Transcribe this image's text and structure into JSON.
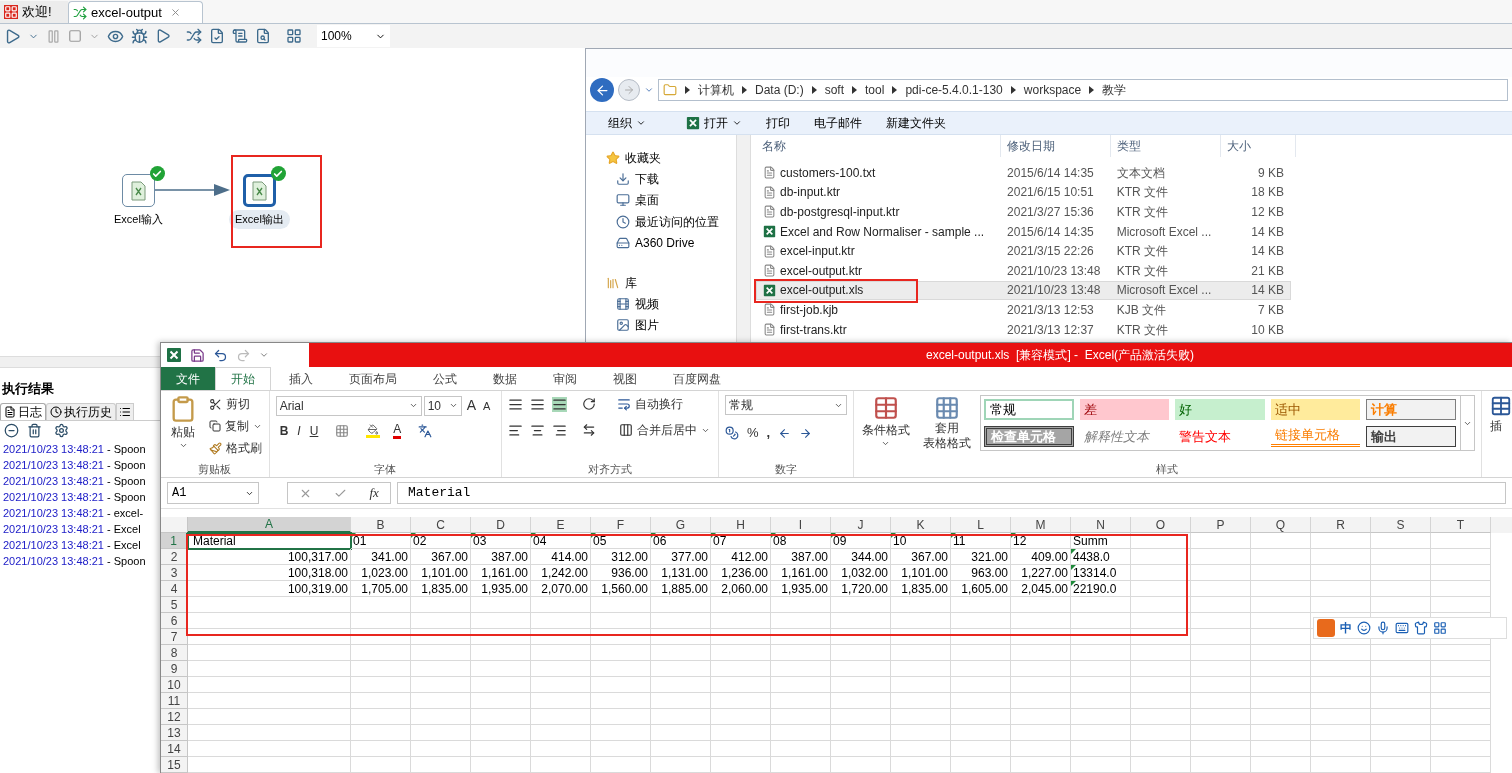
{
  "spoon": {
    "tabs": [
      {
        "label": "欢迎!",
        "selected": false
      },
      {
        "label": "excel-output",
        "selected": true
      }
    ],
    "zoom": "100%",
    "steps": [
      {
        "label": "Excel输入",
        "selected": false
      },
      {
        "label": "Excel输出",
        "selected": true
      }
    ],
    "results": {
      "title": "执行结果",
      "tabs": [
        {
          "label": "日志",
          "selected": true
        },
        {
          "label": "执行历史",
          "selected": false
        }
      ],
      "log": [
        {
          "time": "2021/10/23 13:48:21",
          "message": "- Spoon"
        },
        {
          "time": "2021/10/23 13:48:21",
          "message": "- Spoon"
        },
        {
          "time": "2021/10/23 13:48:21",
          "message": "- Spoon"
        },
        {
          "time": "2021/10/23 13:48:21",
          "message": "- Spoon"
        },
        {
          "time": "2021/10/23 13:48:21",
          "message": "- excel-"
        },
        {
          "time": "2021/10/23 13:48:21",
          "message": "- Excel"
        },
        {
          "time": "2021/10/23 13:48:21",
          "message": "- Excel"
        },
        {
          "time": "2021/10/23 13:48:21",
          "message": "- Spoon"
        }
      ]
    }
  },
  "explorer": {
    "path": [
      "计算机",
      "Data (D:)",
      "soft",
      "tool",
      "pdi-ce-5.4.0.1-130",
      "workspace",
      "教学"
    ],
    "toolbar": [
      "组织",
      "打开",
      "打印",
      "电子邮件",
      "新建文件夹"
    ],
    "nav": [
      {
        "label": "收藏夹",
        "children": [
          {
            "label": "下载"
          },
          {
            "label": "桌面"
          },
          {
            "label": "最近访问的位置"
          },
          {
            "label": "A360 Drive"
          }
        ]
      },
      {
        "label": "库",
        "children": [
          {
            "label": "视频"
          },
          {
            "label": "图片"
          }
        ]
      }
    ],
    "columns": [
      "名称",
      "修改日期",
      "类型",
      "大小"
    ],
    "files": [
      {
        "name": "customers-100.txt",
        "date": "2015/6/14 14:35",
        "type": "文本文档",
        "size": "9 KB",
        "kind": "text",
        "selected": false
      },
      {
        "name": "db-input.ktr",
        "date": "2021/6/15 10:51",
        "type": "KTR 文件",
        "size": "18 KB",
        "kind": "text",
        "selected": false
      },
      {
        "name": "db-postgresql-input.ktr",
        "date": "2021/3/27 15:36",
        "type": "KTR 文件",
        "size": "12 KB",
        "kind": "text",
        "selected": false
      },
      {
        "name": "Excel and Row Normaliser - sample ...",
        "date": "2015/6/14 14:35",
        "type": "Microsoft Excel ...",
        "size": "14 KB",
        "kind": "excel",
        "selected": false
      },
      {
        "name": "excel-input.ktr",
        "date": "2021/3/15 22:26",
        "type": "KTR 文件",
        "size": "14 KB",
        "kind": "text",
        "selected": false
      },
      {
        "name": "excel-output.ktr",
        "date": "2021/10/23 13:48",
        "type": "KTR 文件",
        "size": "21 KB",
        "kind": "text",
        "selected": false
      },
      {
        "name": "excel-output.xls",
        "date": "2021/10/23 13:48",
        "type": "Microsoft Excel ...",
        "size": "14 KB",
        "kind": "excel",
        "selected": true
      },
      {
        "name": "first-job.kjb",
        "date": "2021/3/13 12:53",
        "type": "KJB 文件",
        "size": "7 KB",
        "kind": "text",
        "selected": false
      },
      {
        "name": "first-trans.ktr",
        "date": "2021/3/13 12:37",
        "type": "KTR 文件",
        "size": "10 KB",
        "kind": "text",
        "selected": false
      }
    ]
  },
  "excel": {
    "title": "excel-output.xls  [兼容模式] -  Excel(产品激活失败)",
    "tabs": [
      {
        "label": "文件",
        "selected": false
      },
      {
        "label": "开始",
        "selected": true
      },
      {
        "label": "插入",
        "selected": false
      },
      {
        "label": "页面布局",
        "selected": false
      },
      {
        "label": "公式",
        "selected": false
      },
      {
        "label": "数据",
        "selected": false
      },
      {
        "label": "审阅",
        "selected": false
      },
      {
        "label": "视图",
        "selected": false
      },
      {
        "label": "百度网盘",
        "selected": false
      }
    ],
    "clipboard": {
      "group": "剪贴板",
      "paste": "粘贴",
      "cut": "剪切",
      "copy": "复制",
      "painter": "格式刷"
    },
    "font": {
      "group": "字体",
      "name": "Arial",
      "size": "10",
      "grow": "A",
      "shrink": "A",
      "bold": "B",
      "italic": "I",
      "underline": "U",
      "font_color_label": "A"
    },
    "alignment": {
      "group": "对齐方式",
      "wrap": "自动换行",
      "merge": "合并后居中"
    },
    "number": {
      "group": "数字",
      "format": "常规",
      "percent": "%",
      "comma": ","
    },
    "styles": {
      "group": "样式",
      "conditional": "条件格式",
      "table": [
        "套用",
        "表格格式"
      ],
      "cells": [
        {
          "label": "常规",
          "kind": "normal"
        },
        {
          "label": "差",
          "kind": "bad"
        },
        {
          "label": "好",
          "kind": "good"
        },
        {
          "label": "适中",
          "kind": "neutral"
        },
        {
          "label": "计算",
          "kind": "calculation"
        },
        {
          "label": "检查单元格",
          "kind": "check"
        },
        {
          "label": "解释性文本",
          "kind": "explanatory"
        },
        {
          "label": "警告文本",
          "kind": "warning"
        },
        {
          "label": "链接单元格",
          "kind": "linked"
        },
        {
          "label": "输出",
          "kind": "output"
        }
      ]
    },
    "insert_cut": "插",
    "name_box": "A1",
    "fx": "fx",
    "formula": "Material",
    "columns": [
      {
        "letter": "A",
        "selected": true
      },
      {
        "letter": "B",
        "selected": false
      },
      {
        "letter": "C",
        "selected": false
      },
      {
        "letter": "D",
        "selected": false
      },
      {
        "letter": "E",
        "selected": false
      },
      {
        "letter": "F",
        "selected": false
      },
      {
        "letter": "G",
        "selected": false
      },
      {
        "letter": "H",
        "selected": false
      },
      {
        "letter": "I",
        "selected": false
      },
      {
        "letter": "J",
        "selected": false
      },
      {
        "letter": "K",
        "selected": false
      },
      {
        "letter": "L",
        "selected": false
      },
      {
        "letter": "M",
        "selected": false
      },
      {
        "letter": "N",
        "selected": false
      },
      {
        "letter": "O",
        "selected": false
      },
      {
        "letter": "P",
        "selected": false
      },
      {
        "letter": "Q",
        "selected": false
      },
      {
        "letter": "R",
        "selected": false
      },
      {
        "letter": "S",
        "selected": false
      },
      {
        "letter": "T",
        "selected": false
      }
    ],
    "rows": [
      {
        "number": "1",
        "selected": true,
        "cells": [
          {
            "text": "Material",
            "kind": "text"
          },
          {
            "text": "01",
            "kind": "text_number"
          },
          {
            "text": "02",
            "kind": "text_number"
          },
          {
            "text": "03",
            "kind": "text_number"
          },
          {
            "text": "04",
            "kind": "text_number"
          },
          {
            "text": "05",
            "kind": "text_number"
          },
          {
            "text": "06",
            "kind": "text_number"
          },
          {
            "text": "07",
            "kind": "text_number"
          },
          {
            "text": "08",
            "kind": "text_number"
          },
          {
            "text": "09",
            "kind": "text_number"
          },
          {
            "text": "10",
            "kind": "text_number"
          },
          {
            "text": "11",
            "kind": "text_number"
          },
          {
            "text": "12",
            "kind": "text_number"
          },
          {
            "text": "Summ",
            "kind": "text"
          }
        ]
      },
      {
        "number": "2",
        "selected": false,
        "cells": [
          {
            "text": "100,317.00",
            "kind": "number"
          },
          {
            "text": "341.00",
            "kind": "number"
          },
          {
            "text": "367.00",
            "kind": "number"
          },
          {
            "text": "387.00",
            "kind": "number"
          },
          {
            "text": "414.00",
            "kind": "number"
          },
          {
            "text": "312.00",
            "kind": "number"
          },
          {
            "text": "377.00",
            "kind": "number"
          },
          {
            "text": "412.00",
            "kind": "number"
          },
          {
            "text": "387.00",
            "kind": "number"
          },
          {
            "text": "344.00",
            "kind": "number"
          },
          {
            "text": "367.00",
            "kind": "number"
          },
          {
            "text": "321.00",
            "kind": "number"
          },
          {
            "text": "409.00",
            "kind": "number"
          },
          {
            "text": "4438.0",
            "kind": "text_number"
          }
        ]
      },
      {
        "number": "3",
        "selected": false,
        "cells": [
          {
            "text": "100,318.00",
            "kind": "number"
          },
          {
            "text": "1,023.00",
            "kind": "number"
          },
          {
            "text": "1,101.00",
            "kind": "number"
          },
          {
            "text": "1,161.00",
            "kind": "number"
          },
          {
            "text": "1,242.00",
            "kind": "number"
          },
          {
            "text": "936.00",
            "kind": "number"
          },
          {
            "text": "1,131.00",
            "kind": "number"
          },
          {
            "text": "1,236.00",
            "kind": "number"
          },
          {
            "text": "1,161.00",
            "kind": "number"
          },
          {
            "text": "1,032.00",
            "kind": "number"
          },
          {
            "text": "1,101.00",
            "kind": "number"
          },
          {
            "text": "963.00",
            "kind": "number"
          },
          {
            "text": "1,227.00",
            "kind": "number"
          },
          {
            "text": "13314.0",
            "kind": "text_number"
          }
        ]
      },
      {
        "number": "4",
        "selected": false,
        "cells": [
          {
            "text": "100,319.00",
            "kind": "number"
          },
          {
            "text": "1,705.00",
            "kind": "number"
          },
          {
            "text": "1,835.00",
            "kind": "number"
          },
          {
            "text": "1,935.00",
            "kind": "number"
          },
          {
            "text": "2,070.00",
            "kind": "number"
          },
          {
            "text": "1,560.00",
            "kind": "number"
          },
          {
            "text": "1,885.00",
            "kind": "number"
          },
          {
            "text": "2,060.00",
            "kind": "number"
          },
          {
            "text": "1,935.00",
            "kind": "number"
          },
          {
            "text": "1,720.00",
            "kind": "number"
          },
          {
            "text": "1,835.00",
            "kind": "number"
          },
          {
            "text": "1,605.00",
            "kind": "number"
          },
          {
            "text": "2,045.00",
            "kind": "number"
          },
          {
            "text": "22190.0",
            "kind": "text_number"
          }
        ]
      },
      {
        "number": "5",
        "selected": false
      },
      {
        "number": "6",
        "selected": false
      },
      {
        "number": "7",
        "selected": false
      },
      {
        "number": "8",
        "selected": false
      },
      {
        "number": "9",
        "selected": false
      },
      {
        "number": "10",
        "selected": false
      },
      {
        "number": "11",
        "selected": false
      },
      {
        "number": "12",
        "selected": false
      },
      {
        "number": "13",
        "selected": false
      },
      {
        "number": "14",
        "selected": false
      },
      {
        "number": "15",
        "selected": false
      }
    ]
  },
  "ime": {
    "mode": "中"
  }
}
